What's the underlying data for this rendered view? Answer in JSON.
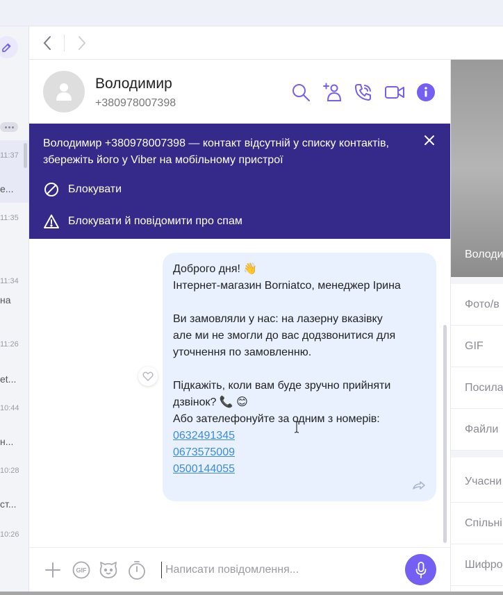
{
  "chat_list": {
    "items": [
      {
        "time": "11:37",
        "preview": "е..."
      },
      {
        "time": "11:35",
        "preview": ""
      },
      {
        "time": "11:34",
        "preview": "на"
      },
      {
        "time": "11:26",
        "preview": "et..."
      },
      {
        "time": "10:44",
        "preview": "н..."
      },
      {
        "time": "10:28",
        "preview": "ст..."
      },
      {
        "time": "10:26",
        "preview": ""
      }
    ]
  },
  "contact": {
    "name": "Володимир",
    "phone": "+380978007398"
  },
  "banner": {
    "text": "Володимир +380978007398 — контакт відсутній у списку контактів, збережіть його у Viber на мобільному пристрої",
    "block_label": "Блокувати",
    "block_report_label": "Блокувати й повідомити про спам"
  },
  "message": {
    "line1": "Доброго дня! 👋",
    "line2": "Інтернет-магазин Borniatco, менеджер Ірина",
    "line3": "Ви замовляли у нас: на лазерну вказівку",
    "line4": "але ми не змогли до вас додзвонитися для",
    "line5": "уточнення по замовленню.",
    "line6": "Підкажіть, коли вам буде зручно прийняти",
    "line7": "дзвінок? 📞 😊",
    "line8": "Або зателефонуйте за одним з номерів:",
    "phones": [
      "0632491345",
      "0673575009",
      "0500144055"
    ]
  },
  "composer": {
    "placeholder": "Написати повідомлення..."
  },
  "info_panel": {
    "photo_name": "Володимир",
    "items": [
      "Фото/в",
      "GIF",
      "Посила",
      "Файли",
      "Учасни",
      "Спільні",
      "Шифро"
    ]
  },
  "colors": {
    "accent": "#7360f2",
    "banner_bg": "#352a8a",
    "bubble_bg": "#e8f1fd",
    "link": "#3b8be0"
  }
}
